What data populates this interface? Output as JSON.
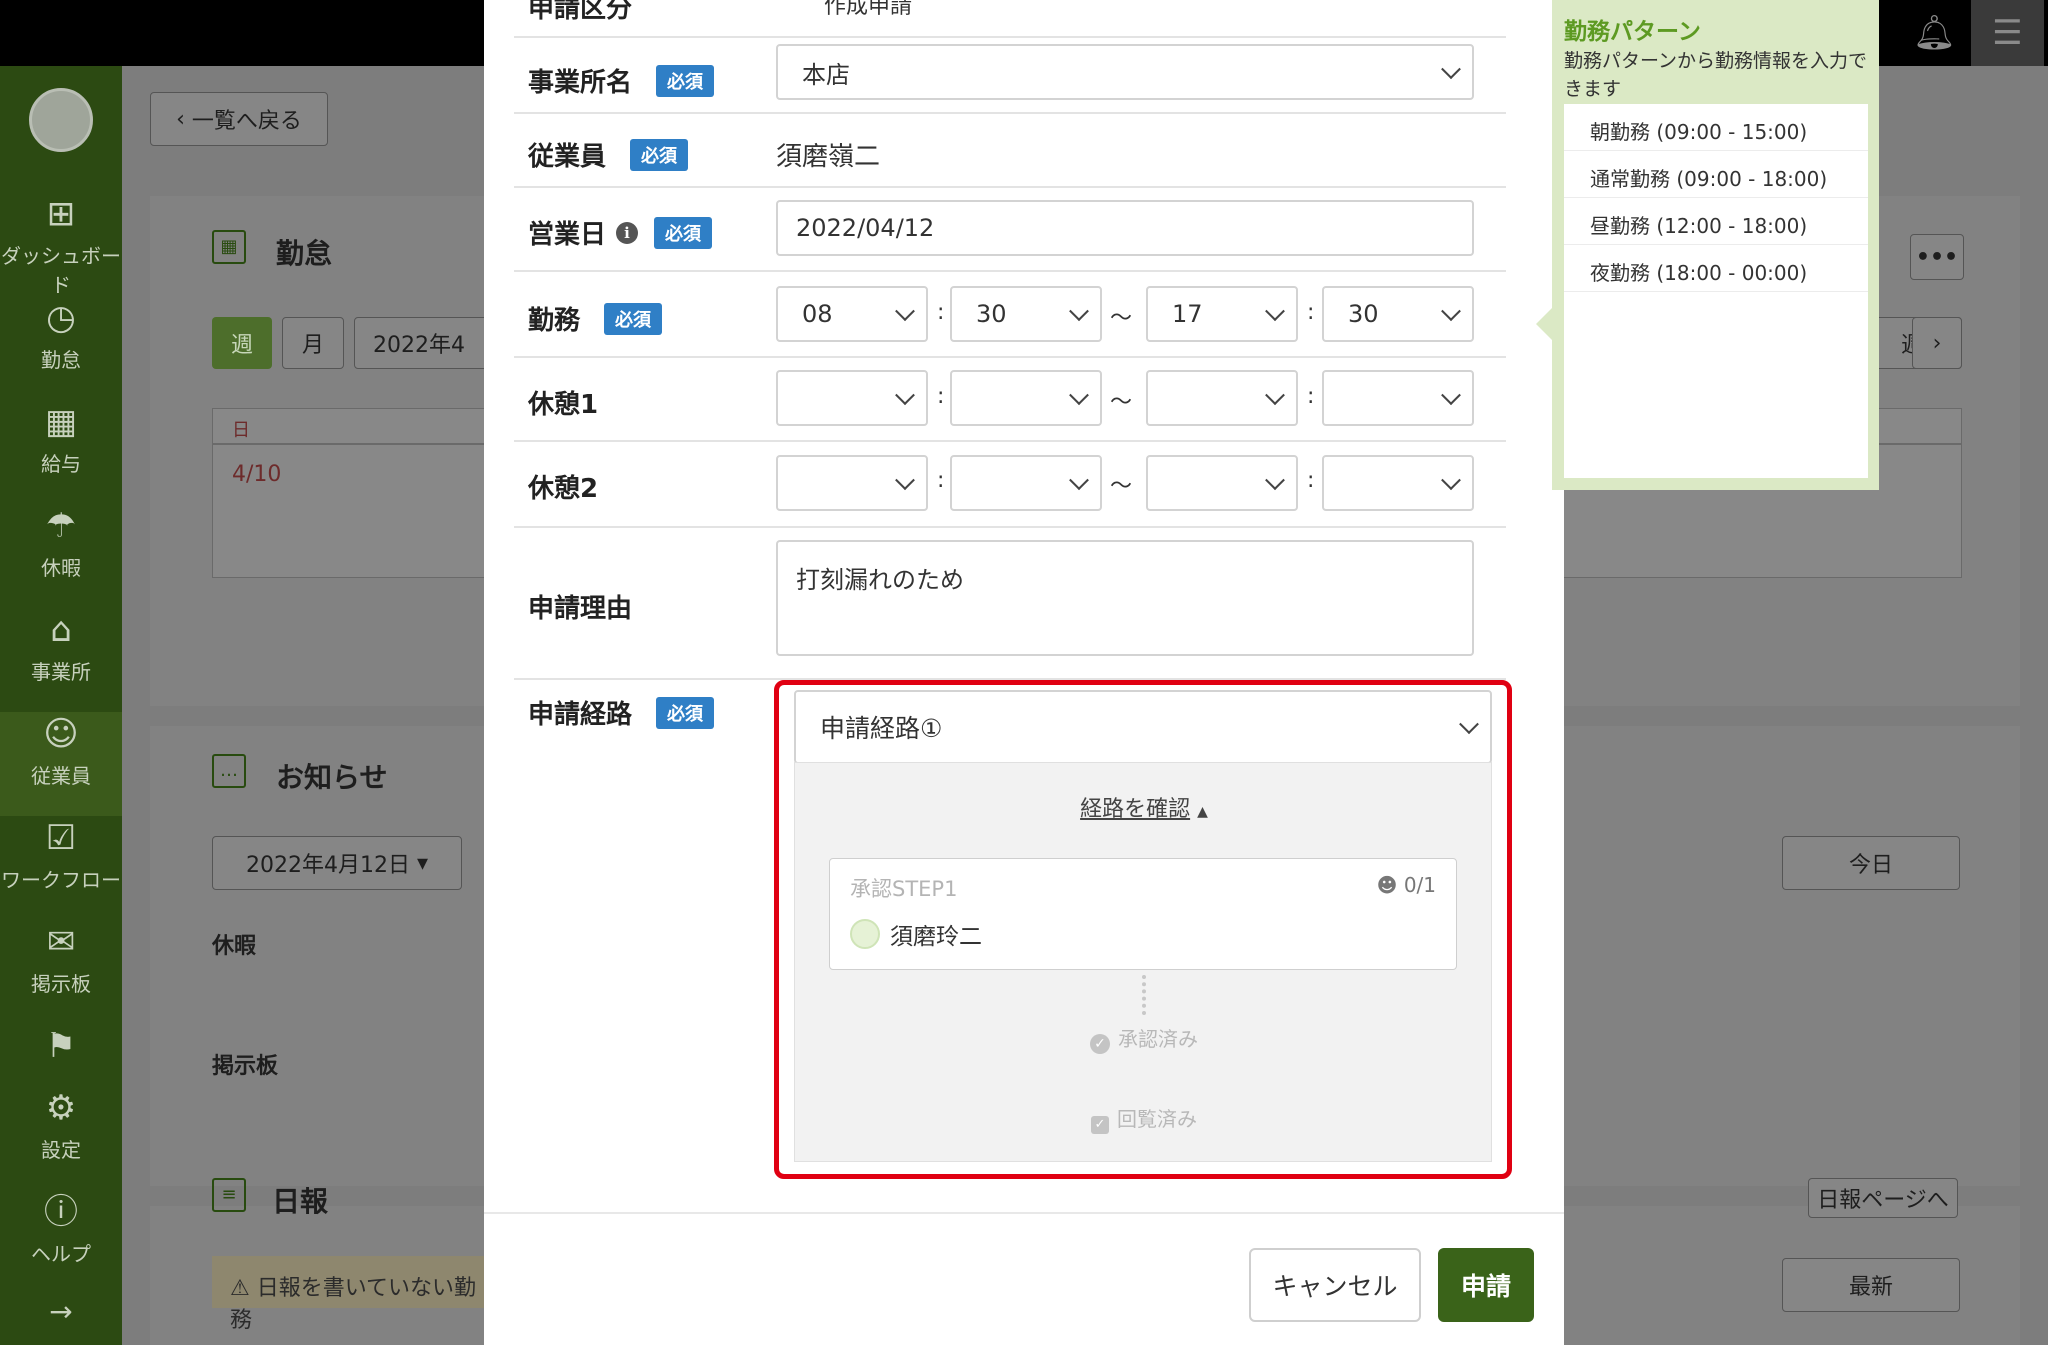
{
  "app": {
    "sidebar": [
      {
        "label": "ダッシュボード",
        "icon": "dashboard-icon"
      },
      {
        "label": "勤怠",
        "icon": "clock-icon"
      },
      {
        "label": "給与",
        "icon": "calculator-icon"
      },
      {
        "label": "休暇",
        "icon": "umbrella-icon"
      },
      {
        "label": "事業所",
        "icon": "home-icon"
      },
      {
        "label": "従業員",
        "icon": "user-icon"
      },
      {
        "label": "ワークフロー",
        "icon": "workflow-icon"
      },
      {
        "label": "掲示板",
        "icon": "message-icon"
      },
      {
        "label": "",
        "icon": "flag-icon"
      },
      {
        "label": "設定",
        "icon": "gear-icon"
      },
      {
        "label": "ヘルプ",
        "icon": "help-icon"
      }
    ],
    "back_button": "一覧へ戻る",
    "attendance": {
      "title": "勤怠",
      "week": "週",
      "month": "月",
      "date_picker": "2022年4",
      "col_day": "日",
      "first_date": "4/10",
      "week_label": "週"
    },
    "notice": {
      "title": "お知らせ",
      "date": "2022年4月12日",
      "today": "今日",
      "leave": "休暇",
      "board": "掲示板"
    },
    "daily_report": {
      "title": "日報",
      "to_page": "日報ページへ",
      "latest": "最新",
      "warning": "日報を書いていない勤務"
    }
  },
  "form": {
    "top_row": {
      "label": "申請区分",
      "value": "作成申請"
    },
    "office": {
      "label": "事業所名",
      "required": "必須",
      "value": "本店"
    },
    "employee": {
      "label": "従業員",
      "required": "必須",
      "value": "須磨嶺二"
    },
    "business_date": {
      "label": "営業日",
      "required": "必須",
      "value": "2022/04/12"
    },
    "work": {
      "label": "勤務",
      "required": "必須",
      "start_h": "08",
      "start_m": "30",
      "end_h": "17",
      "end_m": "30"
    },
    "break1": {
      "label": "休憩1"
    },
    "break2": {
      "label": "休憩2"
    },
    "reason": {
      "label": "申請理由",
      "value": "打刻漏れのため"
    },
    "route": {
      "label": "申請経路",
      "required": "必須",
      "value": "申請経路①",
      "confirm_link": "経路を確認",
      "step_title": "承認STEP1",
      "step_count": "0/1",
      "approver": "須磨玲二",
      "approved": "承認済み",
      "circulated": "回覧済み"
    },
    "separators": {
      "colon": ":",
      "tilde": "〜"
    },
    "cancel": "キャンセル",
    "submit": "申請"
  },
  "work_pattern": {
    "title": "勤務パターン",
    "description": "勤務パターンから勤務情報を入力できます",
    "items": [
      "朝勤務 (09:00 - 15:00)",
      "通常勤務 (09:00 - 18:00)",
      "昼勤務 (12:00 - 18:00)",
      "夜勤務 (18:00 - 00:00)"
    ]
  },
  "colors": {
    "accent": "#3a6319",
    "required_badge": "#2f7fc6",
    "highlight": "#e00012",
    "popover": "#dbe9c5"
  }
}
